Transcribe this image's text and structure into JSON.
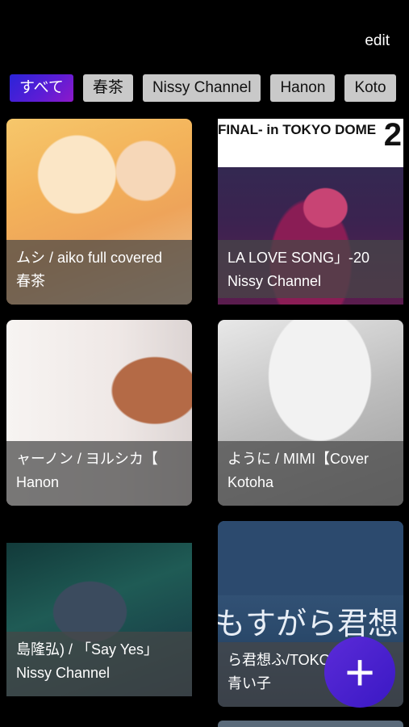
{
  "header": {
    "edit_label": "edit"
  },
  "filters": {
    "chips": [
      {
        "label": "すべて",
        "active": true
      },
      {
        "label": "春茶",
        "active": false
      },
      {
        "label": "Nissy Channel",
        "active": false
      },
      {
        "label": "Hanon",
        "active": false
      },
      {
        "label": "Koto",
        "active": false
      }
    ]
  },
  "cards": [
    {
      "title": "ムシ / aiko  full covered",
      "channel": "春茶",
      "thumb_icon": "anime-illustration"
    },
    {
      "title": " LA LOVE SONG」-20",
      "channel": "Nissy Channel",
      "thumb_icon": "concert-photo",
      "thumb_text": "FINAL- in TOKYO DOME",
      "thumb_badge": "2"
    },
    {
      "title": "ャーノン / ヨルシカ【",
      "channel": "Hanon",
      "thumb_icon": "singer-photo"
    },
    {
      "title": " ように / MIMI【Cover",
      "channel": "Kotoha",
      "thumb_icon": "sketch-illustration"
    },
    {
      "title": "島隆弘) / 「Say Yes」",
      "channel": "Nissy Channel",
      "thumb_icon": "singer-closeup"
    },
    {
      "title": "ら君想ふ/TOKOTOKO",
      "channel": "青い子",
      "thumb_icon": "guitar-photo",
      "thumb_text": "もすがら君想"
    }
  ],
  "fab": {
    "icon": "plus-icon",
    "symbol": "+"
  },
  "colors": {
    "accent": "#3a18c4",
    "chip_bg": "#c9c9c9"
  }
}
